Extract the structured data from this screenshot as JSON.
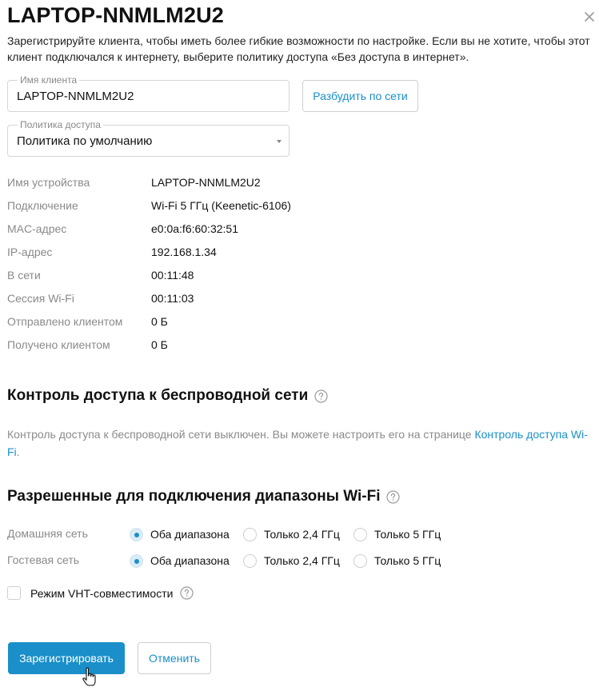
{
  "dialog": {
    "title": "LAPTOP-NNMLM2U2",
    "intro": "Зарегистрируйте клиента, чтобы иметь более гибкие возможности по настройке. Если вы не хотите, чтобы этот клиент подключался к интернету, выберите политику доступа «Без доступа в интернет».",
    "close_icon": "close-icon"
  },
  "client_name": {
    "label": "Имя клиента",
    "value": "LAPTOP-NNMLM2U2"
  },
  "wake_button": "Разбудить по сети",
  "access_policy": {
    "label": "Политика доступа",
    "value": "Политика по умолчанию"
  },
  "info": [
    {
      "key": "Имя устройства",
      "value": "LAPTOP-NNMLM2U2"
    },
    {
      "key": "Подключение",
      "value": "Wi-Fi 5 ГГц (Keenetic-6106)"
    },
    {
      "key": "MAC-адрес",
      "value": "e0:0a:f6:60:32:51"
    },
    {
      "key": "IP-адрес",
      "value": "192.168.1.34"
    },
    {
      "key": "В сети",
      "value": "00:11:48"
    },
    {
      "key": "Сессия Wi-Fi",
      "value": "00:11:03"
    },
    {
      "key": "Отправлено клиентом",
      "value": "0 Б"
    },
    {
      "key": "Получено клиентом",
      "value": "0 Б"
    }
  ],
  "wireless_access": {
    "heading": "Контроль доступа к беспроводной сети",
    "note_text": "Контроль доступа к беспроводной сети выключен. Вы можете настроить его на странице ",
    "note_link": "Контроль доступа Wi-Fi",
    "note_end": "."
  },
  "bands": {
    "heading": "Разрешенные для подключения диапазоны Wi-Fi",
    "options": [
      "Оба диапазона",
      "Только 2,4 ГГц",
      "Только 5 ГГц"
    ],
    "rows": [
      {
        "label": "Домашняя сеть",
        "selected": "Оба диапазона"
      },
      {
        "label": "Гостевая сеть",
        "selected": "Оба диапазона"
      }
    ],
    "vht_label": "Режим VHT-совместимости",
    "vht_checked": false
  },
  "actions": {
    "register": "Зарегистрировать",
    "cancel": "Отменить"
  },
  "colors": {
    "accent": "#1a8fc9",
    "muted": "#8a8a8a",
    "border": "#d6d6d6"
  }
}
